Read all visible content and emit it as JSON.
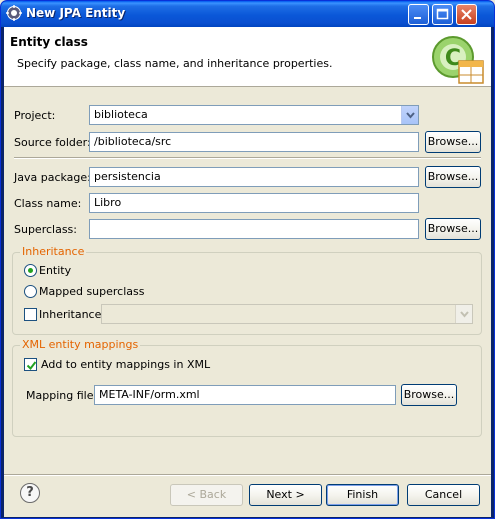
{
  "window": {
    "title": "New JPA Entity",
    "controls": {
      "minimize": "_",
      "maximize": "□",
      "close": "×"
    }
  },
  "banner": {
    "title": "Entity class",
    "description": "Specify package, class name, and inheritance properties.",
    "icon": "jpa-entity-wizard-icon"
  },
  "form": {
    "project_label": "Project:",
    "project_value": "biblioteca",
    "source_folder_label": "Source folder:",
    "source_folder_value": "/biblioteca/src",
    "java_package_label": "Java package:",
    "java_package_value": "persistencia",
    "class_name_label": "Class name:",
    "class_name_value": "Libro",
    "superclass_label": "Superclass:",
    "superclass_value": "",
    "browse_label": "Browse..."
  },
  "inheritance": {
    "group_title": "Inheritance",
    "entity_label": "Entity",
    "mapped_superclass_label": "Mapped superclass",
    "inheritance_label": "Inheritance:",
    "entity_checked": true,
    "inheritance_checked": false
  },
  "xml_mappings": {
    "group_title": "XML entity mappings",
    "add_label": "Add to entity mappings in XML",
    "add_checked": true,
    "mapping_file_label": "Mapping file:",
    "mapping_file_value": "META-INF/orm.xml",
    "browse_label": "Browse..."
  },
  "footer": {
    "help_icon": "?",
    "back_label": "< Back",
    "next_label": "Next >",
    "finish_label": "Finish",
    "cancel_label": "Cancel"
  },
  "colors": {
    "title_bar": "#0a57d8",
    "group_title": "#e46400",
    "dialog_bg": "#ece9d8"
  }
}
